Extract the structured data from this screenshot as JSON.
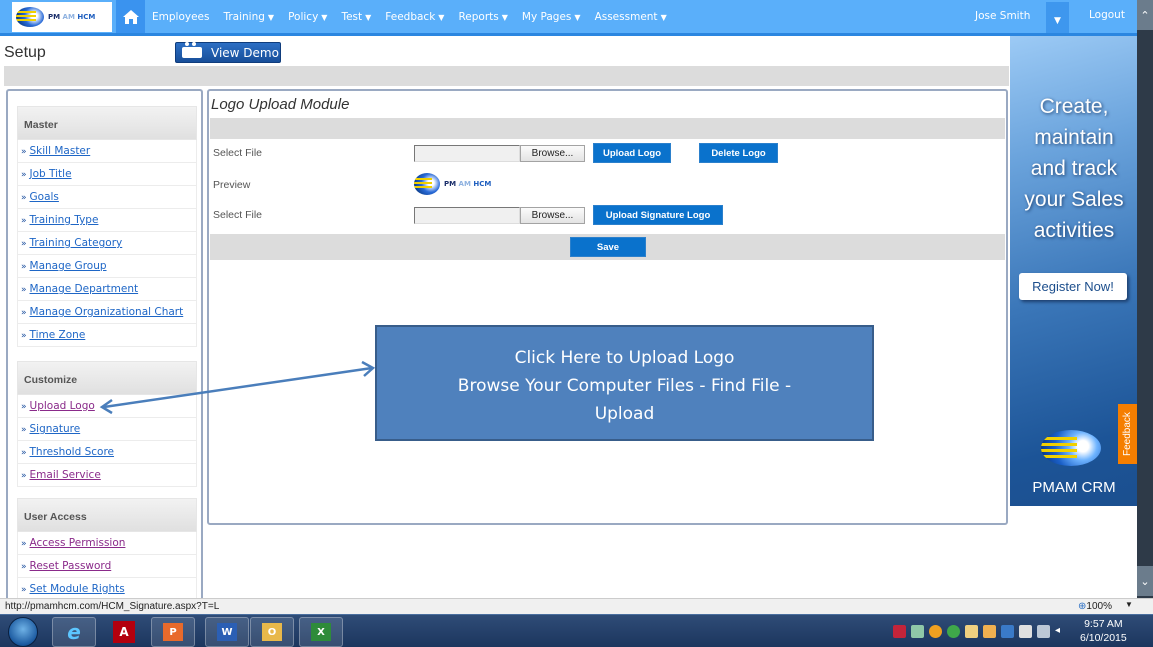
{
  "header": {
    "logo_text_pm": "PM",
    "logo_text_am": "AM",
    "logo_text_hcm": "HCM",
    "home_icon": "home-icon",
    "nav": [
      {
        "label": "Employees",
        "dropdown": false
      },
      {
        "label": "Training",
        "dropdown": true
      },
      {
        "label": "Policy",
        "dropdown": true
      },
      {
        "label": "Test",
        "dropdown": true
      },
      {
        "label": "Feedback",
        "dropdown": true
      },
      {
        "label": "Reports",
        "dropdown": true
      },
      {
        "label": "My Pages",
        "dropdown": true
      },
      {
        "label": "Assessment",
        "dropdown": true
      }
    ],
    "caret": "▼",
    "user_name": "Jose Smith",
    "user_menu_caret": "▼",
    "logout_label": "Logout"
  },
  "subheader": {
    "title": "Setup",
    "view_demo_label": "View Demo"
  },
  "sidebar": {
    "bullet": "»",
    "sections": [
      {
        "title": "Master",
        "items": [
          {
            "label": "Skill Master",
            "visited": false
          },
          {
            "label": "Job Title",
            "visited": false
          },
          {
            "label": "Goals",
            "visited": false
          },
          {
            "label": "Training Type",
            "visited": false
          },
          {
            "label": "Training Category",
            "visited": false
          },
          {
            "label": "Manage Group",
            "visited": false
          },
          {
            "label": "Manage Department",
            "visited": false
          },
          {
            "label": "Manage Organizational Chart",
            "visited": false
          },
          {
            "label": "Time Zone",
            "visited": false
          }
        ]
      },
      {
        "title": "Customize",
        "items": [
          {
            "label": "Upload Logo",
            "visited": true
          },
          {
            "label": "Signature",
            "visited": false
          },
          {
            "label": "Threshold Score",
            "visited": false
          },
          {
            "label": "Email Service",
            "visited": true
          }
        ]
      },
      {
        "title": "User Access",
        "items": [
          {
            "label": "Access Permission",
            "visited": true
          },
          {
            "label": "Reset Password",
            "visited": true
          },
          {
            "label": "Set Module Rights",
            "visited": false
          }
        ]
      }
    ]
  },
  "main": {
    "title": "Logo Upload Module",
    "logo_row": {
      "label": "Select File",
      "file_value": "",
      "browse_label": "Browse...",
      "upload_label": "Upload Logo",
      "delete_label": "Delete Logo"
    },
    "preview_label": "Preview",
    "preview_logo": {
      "pm": "PM",
      "am": "AM",
      "hcm": "HCM"
    },
    "signature_row": {
      "label": "Select File",
      "file_value": "",
      "browse_label": "Browse...",
      "upload_label": "Upload Signature Logo"
    },
    "save_label": "Save"
  },
  "callout": {
    "line1": "Click Here to Upload Logo",
    "line2": "Browse Your Computer Files - Find File  -",
    "line3": "Upload"
  },
  "ad": {
    "lines": [
      "Create,",
      "maintain",
      "and track",
      "your Sales",
      "activities"
    ],
    "register_label": "Register Now!",
    "brand": "PMAM CRM",
    "feedback_tab": "Feedback"
  },
  "statusbar": {
    "url": "http://pmamhcm.com/HCM_Signature.aspx?T=L",
    "zoom": "100%"
  },
  "taskbar": {
    "apps": [
      "Internet Explorer",
      "Adobe Reader",
      "PowerPoint",
      "Word",
      "Outlook",
      "Excel"
    ],
    "time": "9:57 AM",
    "date": "6/10/2015"
  },
  "colors": {
    "nav_bg": "#5aaffa",
    "button_blue": "#0a72cc",
    "callout_bg": "#4f81bd",
    "feedback_orange": "#f57e00",
    "link": "#1e66c6",
    "link_visited": "#8a2a8a"
  }
}
